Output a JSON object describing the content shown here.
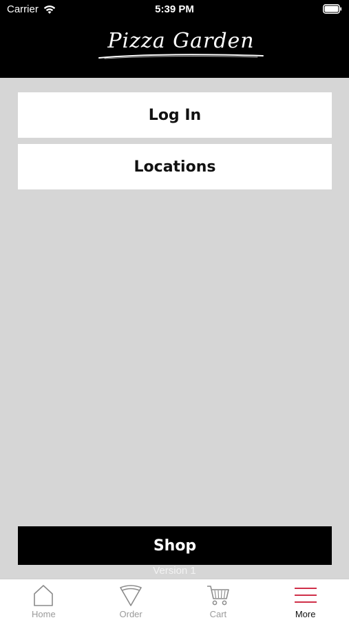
{
  "status_bar": {
    "carrier": "Carrier",
    "time": "5:39 PM"
  },
  "header": {
    "logo_text": "Pizza Garden"
  },
  "menu": {
    "login_label": "Log In",
    "locations_label": "Locations"
  },
  "shop": {
    "label": "Shop",
    "version": "Version 1"
  },
  "tabbar": {
    "items": [
      {
        "label": "Home",
        "icon": "home-icon"
      },
      {
        "label": "Order",
        "icon": "pizza-slice-icon"
      },
      {
        "label": "Cart",
        "icon": "cart-icon"
      },
      {
        "label": "More",
        "icon": "menu-lines-icon"
      }
    ],
    "active": "More",
    "accent_color": "#c8102e"
  }
}
